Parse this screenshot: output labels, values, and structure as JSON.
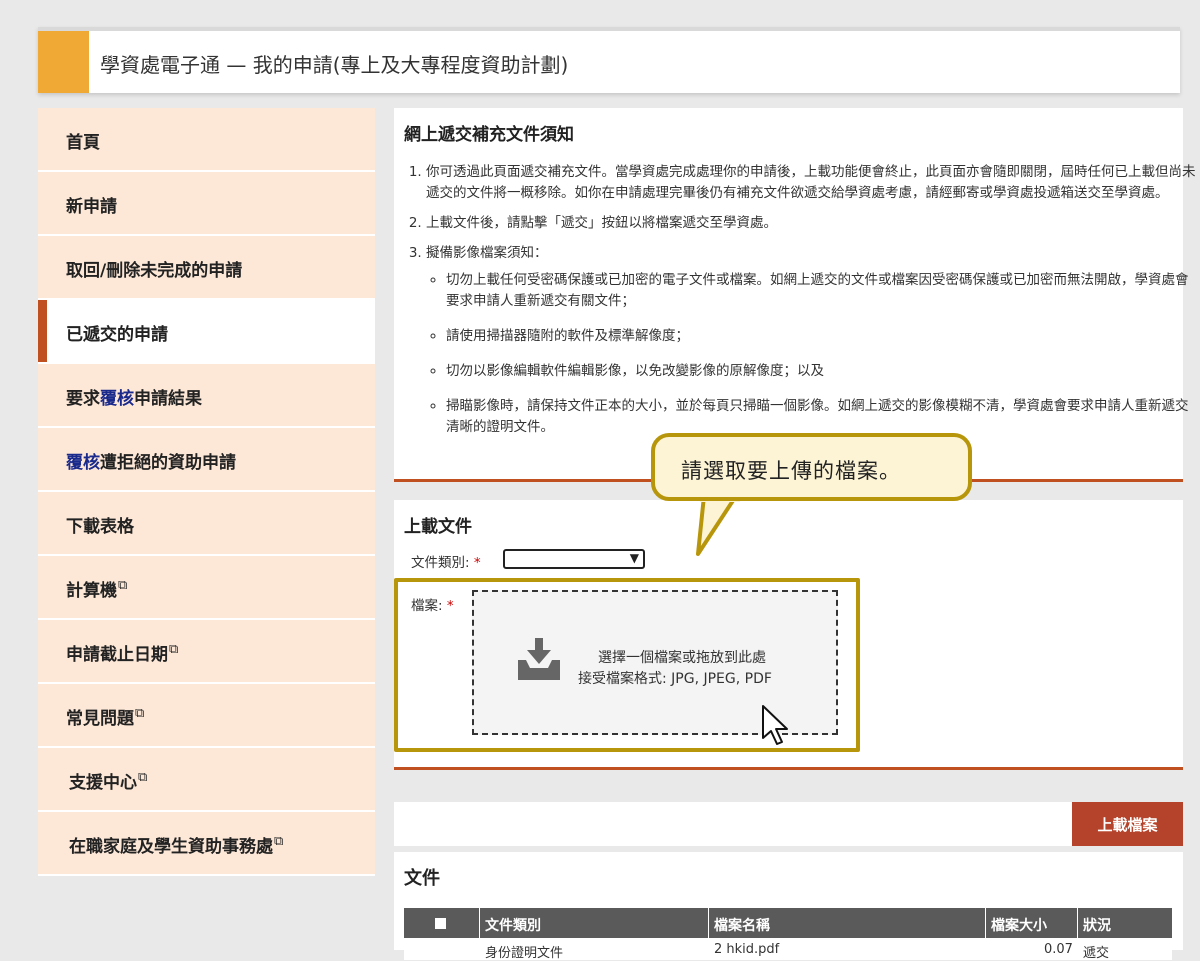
{
  "header": {
    "title": "學資處電子通 — 我的申請(專上及大專程度資助計劃)"
  },
  "sidebar": {
    "items": [
      {
        "label": "首頁"
      },
      {
        "label": "新申請"
      },
      {
        "label": "取回/刪除未完成的申請"
      },
      {
        "label": "已遞交的申請",
        "active": true
      },
      {
        "pre": "要求",
        "hl": "覆核",
        "post": "申請結果"
      },
      {
        "hl": "覆核",
        "post": "遭拒絕的資助申請"
      },
      {
        "label": "下載表格"
      },
      {
        "label": "計算機",
        "external": true
      },
      {
        "label": "申請截止日期",
        "external": true
      },
      {
        "label": "常見問題",
        "external": true
      },
      {
        "label": "支援中心",
        "external": true
      },
      {
        "label": "在職家庭及學生資助事務處",
        "external": true
      }
    ],
    "external_glyph": "⧉"
  },
  "notice": {
    "title": "網上遞交補充文件須知",
    "items": [
      "你可透過此頁面遞交補充文件。當學資處完成處理你的申請後，上載功能便會終止，此頁面亦會隨即關閉，屆時任何已上載但尚未遞交的文件將一概移除。如你在申請處理完畢後仍有補充文件欲遞交給學資處考慮，請經郵寄或學資處投遞箱送交至學資處。",
      "上載文件後，請點擊「遞交」按鈕以將檔案遞交至學資處。",
      "擬備影像檔案須知："
    ],
    "subitems": [
      "切勿上載任何受密碼保護或已加密的電子文件或檔案。如網上遞交的文件或檔案因受密碼保護或已加密而無法開啟，學資處會要求申請人重新遞交有關文件；",
      "請使用掃描器隨附的軟件及標準解像度；",
      "切勿以影像編輯軟件編輯影像，以免改變影像的原解像度；以及",
      "掃瞄影像時，請保持文件正本的大小，並於每頁只掃瞄一個影像。如網上遞交的影像模糊不清，學資處會要求申請人重新遞交清晰的證明文件。"
    ]
  },
  "upload": {
    "title": "上載文件",
    "category_label": "文件類別:",
    "file_label": "檔案:",
    "required_mark": "*",
    "category_value": "",
    "dropzone_line1": "選擇一個檔案或拖放到此處",
    "dropzone_line2": "接受檔案格式: JPG, JPEG, PDF"
  },
  "callout": {
    "text": "請選取要上傳的檔案。"
  },
  "upload_button": {
    "label": "上載檔案"
  },
  "documents": {
    "title": "文件",
    "columns": [
      "文件類別",
      "檔案名稱",
      "檔案大小",
      "狀況"
    ],
    "rows": [
      {
        "category": "身份證明文件",
        "filename": "2 hkid.pdf",
        "size": "0.07",
        "status": "遞交"
      }
    ]
  },
  "colors": {
    "accent": "#f0a934",
    "brand": "#c0501f",
    "highlight": "#b8960c",
    "button": "#b5422a"
  }
}
